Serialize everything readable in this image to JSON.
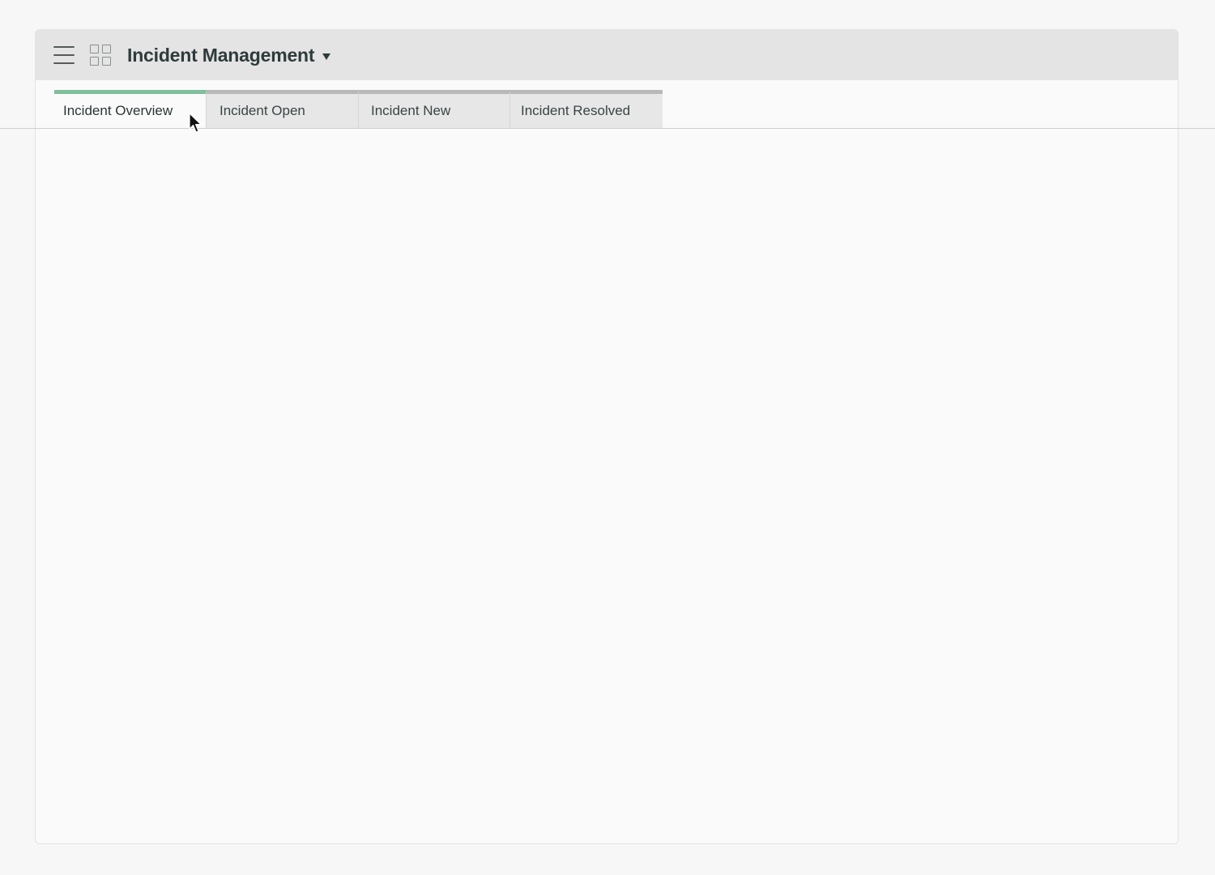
{
  "header": {
    "app_title": "Incident Management",
    "menu_icon": "hamburger-menu-icon",
    "grid_icon": "app-grid-icon",
    "caret_icon": "caret-down-icon"
  },
  "tabs": [
    {
      "label": "Incident Overview",
      "active": true
    },
    {
      "label": "Incident Open",
      "active": false
    },
    {
      "label": "Incident New",
      "active": false
    },
    {
      "label": "Incident Resolved",
      "active": false
    }
  ],
  "colors": {
    "active_tab_accent": "#7fbf9c",
    "inactive_tab_accent": "#b8b8b8",
    "header_bg": "#e4e4e4",
    "title_text": "#2e3b3b"
  }
}
